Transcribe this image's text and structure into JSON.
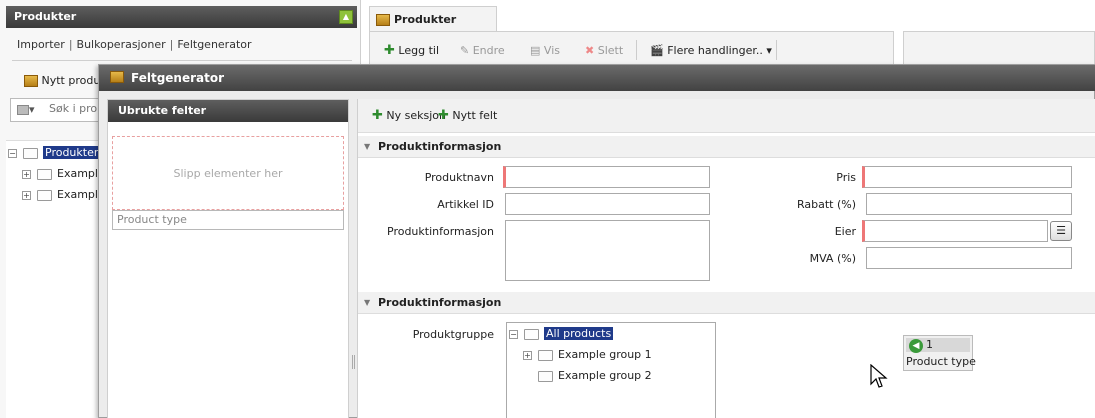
{
  "left_panel": {
    "title": "Produkter",
    "links": [
      "Importer",
      "Bulkoperasjoner",
      "Feltgenerator"
    ],
    "new_button": "Nytt produ",
    "search_placeholder": "Søk i pro",
    "tree": {
      "root": "Produkter",
      "children": [
        "Example",
        "Example"
      ]
    }
  },
  "tab": {
    "label": "Produkter"
  },
  "toolbar": {
    "add": "Legg til",
    "edit": "Endre",
    "view": "Vis",
    "delete": "Slett",
    "more": "Flere handlinger.."
  },
  "dialog": {
    "title": "Feltgenerator",
    "unused_fields": {
      "title": "Ubrukte felter",
      "drop_hint": "Slipp elementer her",
      "item": "Product type"
    },
    "toolbar": {
      "new_section": "Ny seksjon",
      "new_field": "Nytt felt"
    },
    "section1": {
      "title": "Produktinformasjon",
      "fields_left": [
        {
          "label": "Produktnavn",
          "required": true
        },
        {
          "label": "Artikkel ID",
          "required": false
        },
        {
          "label": "Produktinformasjon",
          "required": false
        }
      ],
      "fields_right": [
        {
          "label": "Pris",
          "required": true
        },
        {
          "label": "Rabatt (%)",
          "required": false
        },
        {
          "label": "Eier",
          "required": true
        },
        {
          "label": "MVA (%)",
          "required": false
        }
      ]
    },
    "section2": {
      "title": "Produktinformasjon",
      "field_label": "Produktgruppe",
      "tree": {
        "root": "All products",
        "children": [
          "Example group 1",
          "Example group 2"
        ]
      }
    },
    "drag_chip": {
      "count": "1",
      "label": "Product type"
    }
  },
  "colors": {
    "required_marker": "#e77777",
    "selection": "#1f3a8a",
    "add_icon": "#2e8b2e",
    "header_dark": "#424242"
  }
}
